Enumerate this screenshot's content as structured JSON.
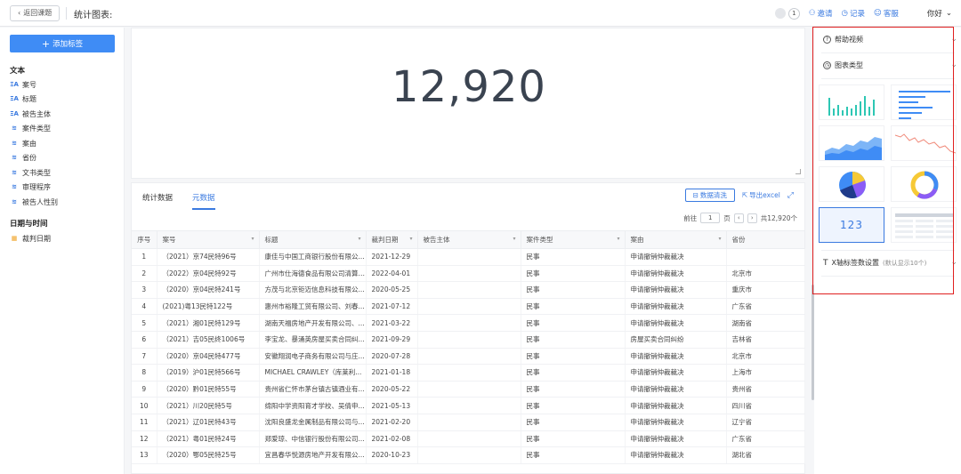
{
  "topbar": {
    "back_label": "返回课题",
    "title": "统计图表:",
    "badge_count": "1",
    "invite": "邀请",
    "records": "记录",
    "service": "客服",
    "user": "你好"
  },
  "sidebar": {
    "add_tag": "添加标签",
    "group_text": "文本",
    "text_items": [
      {
        "label": "案号",
        "icon": "text-field-icon"
      },
      {
        "label": "标题",
        "icon": "text-field-icon"
      },
      {
        "label": "被告主体",
        "icon": "text-field-icon"
      },
      {
        "label": "案件类型",
        "icon": "layers-icon"
      },
      {
        "label": "案由",
        "icon": "layers-icon"
      },
      {
        "label": "省份",
        "icon": "layers-icon"
      },
      {
        "label": "文书类型",
        "icon": "layers-icon"
      },
      {
        "label": "审理程序",
        "icon": "layers-icon"
      },
      {
        "label": "被告人性别",
        "icon": "layers-icon"
      }
    ],
    "group_date": "日期与时间",
    "date_items": [
      {
        "label": "裁判日期",
        "icon": "calendar-icon"
      }
    ]
  },
  "metric": {
    "value": "12,920"
  },
  "panel": {
    "tab_stats": "统计数据",
    "tab_meta": "元数据",
    "clean_btn": "数据清洗",
    "export_btn": "导出excel",
    "pager": {
      "prefix": "前往",
      "page": "1",
      "suffix": "页",
      "total": "共12,920个"
    },
    "columns": [
      "序号",
      "案号",
      "标题",
      "裁判日期",
      "被告主体",
      "案件类型",
      "案由",
      "省份"
    ],
    "rows": [
      [
        "1",
        "（2021）京74民特96号",
        "康佳与中国工商银行股份有限公...",
        "2021-12-29",
        "",
        "民事",
        "申请撤销仲裁裁决",
        ""
      ],
      [
        "2",
        "（2022）京04民特92号",
        "广州市仕海德食品有限公司清算组与...",
        "2022-04-01",
        "",
        "民事",
        "申请撤销仲裁裁决",
        "北京市"
      ],
      [
        "3",
        "（2020）京04民特241号",
        "方茂与北京钜迈信息科技有限公...",
        "2020-05-25",
        "",
        "民事",
        "申请撤销仲裁裁决",
        "重庆市"
      ],
      [
        "4",
        "(2021)粤13民特122号",
        "惠州市裕隆工贸有限公司、刘春...",
        "2021-07-12",
        "",
        "民事",
        "申请撤销仲裁裁决",
        "广东省"
      ],
      [
        "5",
        "（2021）湘01民特129号",
        "湖南天福房地产开发有限公司、...",
        "2021-03-22",
        "",
        "民事",
        "申请撤销仲裁裁决",
        "湖南省"
      ],
      [
        "6",
        "（2021）吉05民终1006号",
        "李宝龙、暴涌英房屋买卖合同纠...",
        "2021-09-29",
        "",
        "民事",
        "房屋买卖合同纠纷",
        "吉林省"
      ],
      [
        "7",
        "（2020）京04民特477号",
        "安徽翔润电子商务有限公司与庄...",
        "2020-07-28",
        "",
        "民事",
        "申请撤销仲裁裁决",
        "北京市"
      ],
      [
        "8",
        "（2019）沪01民特566号",
        "MICHAEL CRAWLEY（库莱利...",
        "2021-01-18",
        "",
        "民事",
        "申请撤销仲裁裁决",
        "上海市"
      ],
      [
        "9",
        "（2020）黔01民特55号",
        "贵州省仁怀市茅台镇古镇酒业有...",
        "2020-05-22",
        "",
        "民事",
        "申请撤销仲裁裁决",
        "贵州省"
      ],
      [
        "10",
        "（2021）川20民特5号",
        "绵阳中学资阳育才学校、吴倩申...",
        "2021-05-13",
        "",
        "民事",
        "申请撤销仲裁裁决",
        "四川省"
      ],
      [
        "11",
        "（2021）辽01民特43号",
        "沈阳良盛龙金属制品有限公司与...",
        "2021-02-20",
        "",
        "民事",
        "申请撤销仲裁裁决",
        "辽宁省"
      ],
      [
        "12",
        "（2021）粤01民特24号",
        "郑爱琼、中信银行股份有限公司...",
        "2021-02-08",
        "",
        "民事",
        "申请撤销仲裁裁决",
        "广东省"
      ],
      [
        "13",
        "（2020）鄂05民特25号",
        "宜昌春华悦源房地产开发有限公...",
        "2020-10-23",
        "",
        "民事",
        "申请撤销仲裁裁决",
        "湖北省"
      ]
    ]
  },
  "right_panel": {
    "help_video": "帮助视频",
    "chart_type": "图表类型",
    "selected_option": "123",
    "x_axis_setting": "X轴标签数设置",
    "x_axis_hint": "(默认显示10个)"
  },
  "colors": {
    "accent": "#3a7ae0",
    "highlight_frame": "#e02020"
  }
}
